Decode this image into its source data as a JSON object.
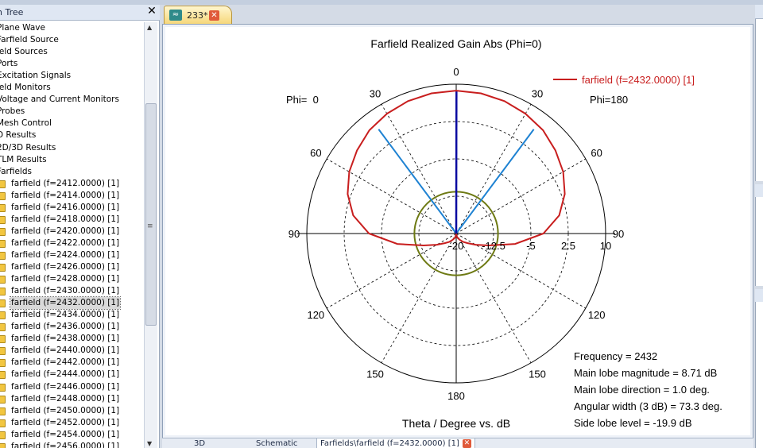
{
  "tree": {
    "title": "n Tree",
    "close_label": "✕",
    "items": [
      "Plane Wave",
      "Farfield Source",
      "ield Sources",
      "Ports",
      "Excitation Signals",
      "ield Monitors",
      "Voltage and Current Monitors",
      "Probes",
      "Mesh Control",
      "D Results",
      "2D/3D Results",
      "TLM Results",
      "Farfields"
    ],
    "farfields": [
      "farfield (f=2412.0000) [1]",
      "farfield (f=2414.0000) [1]",
      "farfield (f=2416.0000) [1]",
      "farfield (f=2418.0000) [1]",
      "farfield (f=2420.0000) [1]",
      "farfield (f=2422.0000) [1]",
      "farfield (f=2424.0000) [1]",
      "farfield (f=2426.0000) [1]",
      "farfield (f=2428.0000) [1]",
      "farfield (f=2430.0000) [1]",
      "farfield (f=2432.0000) [1]",
      "farfield (f=2434.0000) [1]",
      "farfield (f=2436.0000) [1]",
      "farfield (f=2438.0000) [1]",
      "farfield (f=2440.0000) [1]",
      "farfield (f=2442.0000) [1]",
      "farfield (f=2444.0000) [1]",
      "farfield (f=2446.0000) [1]",
      "farfield (f=2448.0000) [1]",
      "farfield (f=2450.0000) [1]",
      "farfield (f=2452.0000) [1]",
      "farfield (f=2454.0000) [1]",
      "farfield (f=2456.0000) [1]"
    ],
    "selected_index": 10
  },
  "doc_tab": {
    "label": "233*",
    "icon": "wave-icon",
    "close_label": "✕"
  },
  "bottom_tabs": {
    "tab_3d": "3D",
    "tab_schematic": "Schematic",
    "tab_farfield": "Farfields\\farfield (f=2432.0000) [1]",
    "close_label": "✕"
  },
  "colors": {
    "pattern": "#c81e1e",
    "beam": "#1e82d2",
    "main_dir": "#0a0aa0",
    "sidelobe": "#6e7a14",
    "grid": "#000000"
  },
  "chart_data": {
    "type": "polar",
    "title": "Farfield Realized Gain Abs (Phi=0)",
    "xlabel": "Theta / Degree vs. dB",
    "phi_left": "Phi=  0",
    "phi_right": "Phi=180",
    "angle_labels": [
      "0",
      "30",
      "60",
      "90",
      "120",
      "150",
      "180",
      "150",
      "120",
      "90",
      "60",
      "30"
    ],
    "radial_labels": [
      "-20",
      "-12.5",
      "-5",
      "2.5",
      "10"
    ],
    "r_range_db": [
      -20,
      10
    ],
    "legend": "farfield (f=2432.0000) [1]",
    "series": [
      {
        "name": "farfield (f=2432.0000) [1]",
        "theta_deg": [
          0,
          10,
          20,
          30,
          40,
          50,
          60,
          70,
          80,
          90,
          100,
          110,
          120,
          130,
          140,
          150,
          160,
          170,
          180
        ],
        "gain_db": [
          8.71,
          8.6,
          8.3,
          7.8,
          7.1,
          6.0,
          4.8,
          3.2,
          1.0,
          -2.5,
          -8.0,
          -13.0,
          -15.5,
          -17.0,
          -17.8,
          -18.5,
          -19.0,
          -19.5,
          -19.9
        ]
      }
    ],
    "beamwidth_lines_deg": [
      -36.65,
      36.65
    ],
    "main_direction_deg": 1.0,
    "sidelobe_level_db": -19.9,
    "annotations": [
      "Frequency = 2432",
      "Main lobe magnitude =     8.71 dB",
      "Main lobe direction =    1.0 deg.",
      "Angular width (3 dB) =   73.3 deg.",
      "Side lobe level =  -19.9 dB"
    ]
  }
}
